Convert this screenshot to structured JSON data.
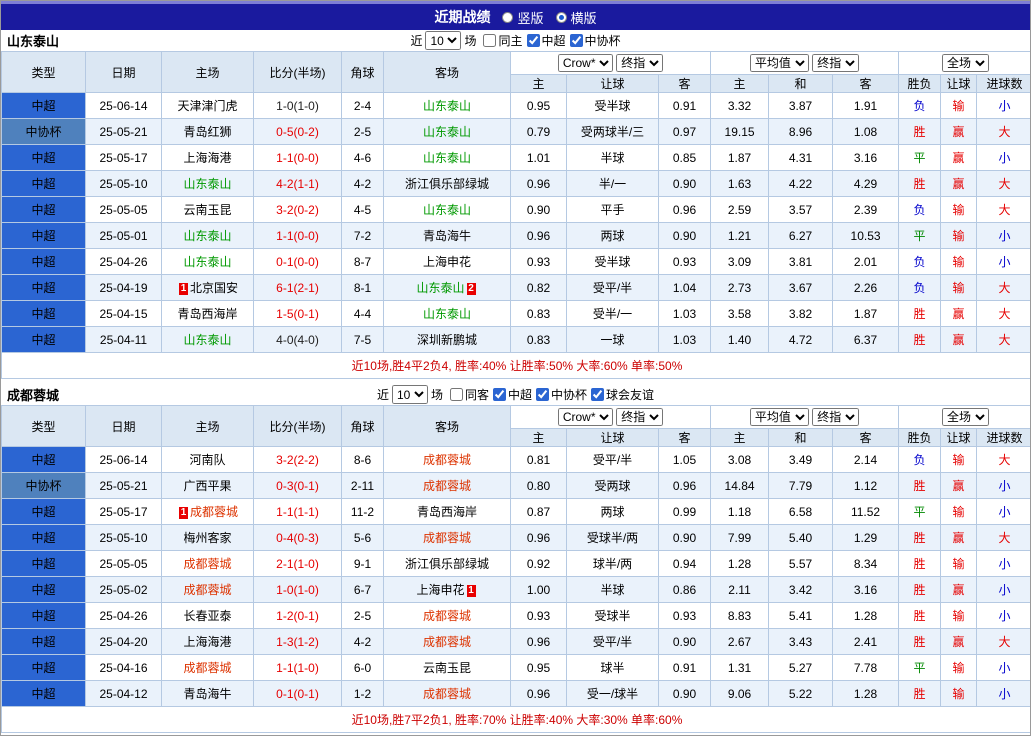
{
  "title_bar": {
    "title": "近期战绩",
    "radio_vertical": "竖版",
    "radio_horizontal": "横版"
  },
  "colors": {
    "league": {
      "中超": "#2b65d2",
      "中协杯": "#4f81bd"
    },
    "score": "#e60000",
    "score_dark": "#222222",
    "result_map": {
      "胜": "#e60000",
      "平": "#008800",
      "负": "#0000cc",
      "赢": "#e60000",
      "输": "#e60000",
      "大": "#e60000",
      "小": "#0000cc"
    }
  },
  "tables": [
    {
      "team": "山东泰山",
      "team_color": "#009900",
      "filter": {
        "near_label": "近",
        "count": "10",
        "games_label": "场",
        "checkboxes": [
          {
            "label": "同主",
            "checked": false
          },
          {
            "label": "中超",
            "checked": true
          },
          {
            "label": "中协杯",
            "checked": true
          }
        ]
      },
      "header": {
        "cols": [
          "类型",
          "日期",
          "主场",
          "比分(半场)",
          "角球",
          "客场"
        ],
        "odds_group": {
          "select1": "Crow*",
          "select2": "终指",
          "cols": [
            "主",
            "让球",
            "客"
          ]
        },
        "avg_group": {
          "select1": "平均值",
          "select2": "终指",
          "cols": [
            "主",
            "和",
            "客"
          ]
        },
        "result_group": {
          "select": "全场",
          "cols": [
            "胜负",
            "让球",
            "进球数"
          ]
        }
      },
      "rows": [
        {
          "league": "中超",
          "date": "25-06-14",
          "home": "天津津门虎",
          "home_cards": 0,
          "score": "1-0(1-0)",
          "score_dark": true,
          "corners": "2-4",
          "away": "山东泰山",
          "away_cards": 0,
          "highlight": "away",
          "odds_home": "0.95",
          "handicap": "受半球",
          "odds_away": "0.91",
          "avg_home": "3.32",
          "avg_draw": "3.87",
          "avg_away": "1.91",
          "res_match": "负",
          "res_handicap": "输",
          "res_goals": "小"
        },
        {
          "league": "中协杯",
          "date": "25-05-21",
          "home": "青岛红狮",
          "home_cards": 0,
          "score": "0-5(0-2)",
          "score_dark": false,
          "corners": "2-5",
          "away": "山东泰山",
          "away_cards": 0,
          "highlight": "away",
          "odds_home": "0.79",
          "handicap": "受两球半/三",
          "odds_away": "0.97",
          "avg_home": "19.15",
          "avg_draw": "8.96",
          "avg_away": "1.08",
          "res_match": "胜",
          "res_handicap": "赢",
          "res_goals": "大"
        },
        {
          "league": "中超",
          "date": "25-05-17",
          "home": "上海海港",
          "home_cards": 0,
          "score": "1-1(0-0)",
          "score_dark": false,
          "corners": "4-6",
          "away": "山东泰山",
          "away_cards": 0,
          "highlight": "away",
          "odds_home": "1.01",
          "handicap": "半球",
          "odds_away": "0.85",
          "avg_home": "1.87",
          "avg_draw": "4.31",
          "avg_away": "3.16",
          "res_match": "平",
          "res_handicap": "赢",
          "res_goals": "小"
        },
        {
          "league": "中超",
          "date": "25-05-10",
          "home": "山东泰山",
          "home_cards": 0,
          "score": "4-2(1-1)",
          "score_dark": false,
          "corners": "4-2",
          "away": "浙江俱乐部绿城",
          "away_cards": 0,
          "highlight": "home",
          "odds_home": "0.96",
          "handicap": "半/一",
          "odds_away": "0.90",
          "avg_home": "1.63",
          "avg_draw": "4.22",
          "avg_away": "4.29",
          "res_match": "胜",
          "res_handicap": "赢",
          "res_goals": "大"
        },
        {
          "league": "中超",
          "date": "25-05-05",
          "home": "云南玉昆",
          "home_cards": 0,
          "score": "3-2(0-2)",
          "score_dark": false,
          "corners": "4-5",
          "away": "山东泰山",
          "away_cards": 0,
          "highlight": "away",
          "odds_home": "0.90",
          "handicap": "平手",
          "odds_away": "0.96",
          "avg_home": "2.59",
          "avg_draw": "3.57",
          "avg_away": "2.39",
          "res_match": "负",
          "res_handicap": "输",
          "res_goals": "大"
        },
        {
          "league": "中超",
          "date": "25-05-01",
          "home": "山东泰山",
          "home_cards": 0,
          "score": "1-1(0-0)",
          "score_dark": false,
          "corners": "7-2",
          "away": "青岛海牛",
          "away_cards": 0,
          "highlight": "home",
          "odds_home": "0.96",
          "handicap": "两球",
          "odds_away": "0.90",
          "avg_home": "1.21",
          "avg_draw": "6.27",
          "avg_away": "10.53",
          "res_match": "平",
          "res_handicap": "输",
          "res_goals": "小"
        },
        {
          "league": "中超",
          "date": "25-04-26",
          "home": "山东泰山",
          "home_cards": 0,
          "score": "0-1(0-0)",
          "score_dark": false,
          "corners": "8-7",
          "away": "上海申花",
          "away_cards": 0,
          "highlight": "home",
          "odds_home": "0.93",
          "handicap": "受半球",
          "odds_away": "0.93",
          "avg_home": "3.09",
          "avg_draw": "3.81",
          "avg_away": "2.01",
          "res_match": "负",
          "res_handicap": "输",
          "res_goals": "小"
        },
        {
          "league": "中超",
          "date": "25-04-19",
          "home": "北京国安",
          "home_cards": 1,
          "score": "6-1(2-1)",
          "score_dark": false,
          "corners": "8-1",
          "away": "山东泰山",
          "away_cards": 2,
          "highlight": "away",
          "odds_home": "0.82",
          "handicap": "受平/半",
          "odds_away": "1.04",
          "avg_home": "2.73",
          "avg_draw": "3.67",
          "avg_away": "2.26",
          "res_match": "负",
          "res_handicap": "输",
          "res_goals": "大"
        },
        {
          "league": "中超",
          "date": "25-04-15",
          "home": "青岛西海岸",
          "home_cards": 0,
          "score": "1-5(0-1)",
          "score_dark": false,
          "corners": "4-4",
          "away": "山东泰山",
          "away_cards": 0,
          "highlight": "away",
          "odds_home": "0.83",
          "handicap": "受半/一",
          "odds_away": "1.03",
          "avg_home": "3.58",
          "avg_draw": "3.82",
          "avg_away": "1.87",
          "res_match": "胜",
          "res_handicap": "赢",
          "res_goals": "大"
        },
        {
          "league": "中超",
          "date": "25-04-11",
          "home": "山东泰山",
          "home_cards": 0,
          "score": "4-0(4-0)",
          "score_dark": true,
          "corners": "7-5",
          "away": "深圳新鹏城",
          "away_cards": 0,
          "highlight": "home",
          "odds_home": "0.83",
          "handicap": "一球",
          "odds_away": "1.03",
          "avg_home": "1.40",
          "avg_draw": "4.72",
          "avg_away": "6.37",
          "res_match": "胜",
          "res_handicap": "赢",
          "res_goals": "大"
        }
      ],
      "summary": "近10场,胜4平2负4, 胜率:40% 让胜率:50% 大率:60% 单率:50%"
    },
    {
      "team": "成都蓉城",
      "team_color": "#dd3300",
      "filter": {
        "near_label": "近",
        "count": "10",
        "games_label": "场",
        "checkboxes": [
          {
            "label": "同客",
            "checked": false
          },
          {
            "label": "中超",
            "checked": true
          },
          {
            "label": "中协杯",
            "checked": true
          },
          {
            "label": "球会友谊",
            "checked": true
          }
        ]
      },
      "header": {
        "cols": [
          "类型",
          "日期",
          "主场",
          "比分(半场)",
          "角球",
          "客场"
        ],
        "odds_group": {
          "select1": "Crow*",
          "select2": "终指",
          "cols": [
            "主",
            "让球",
            "客"
          ]
        },
        "avg_group": {
          "select1": "平均值",
          "select2": "终指",
          "cols": [
            "主",
            "和",
            "客"
          ]
        },
        "result_group": {
          "select": "全场",
          "cols": [
            "胜负",
            "让球",
            "进球数"
          ]
        }
      },
      "rows": [
        {
          "league": "中超",
          "date": "25-06-14",
          "home": "河南队",
          "home_cards": 0,
          "score": "3-2(2-2)",
          "score_dark": false,
          "corners": "8-6",
          "away": "成都蓉城",
          "away_cards": 0,
          "highlight": "away",
          "odds_home": "0.81",
          "handicap": "受平/半",
          "odds_away": "1.05",
          "avg_home": "3.08",
          "avg_draw": "3.49",
          "avg_away": "2.14",
          "res_match": "负",
          "res_handicap": "输",
          "res_goals": "大"
        },
        {
          "league": "中协杯",
          "date": "25-05-21",
          "home": "广西平果",
          "home_cards": 0,
          "score": "0-3(0-1)",
          "score_dark": false,
          "corners": "2-11",
          "away": "成都蓉城",
          "away_cards": 0,
          "highlight": "away",
          "odds_home": "0.80",
          "handicap": "受两球",
          "odds_away": "0.96",
          "avg_home": "14.84",
          "avg_draw": "7.79",
          "avg_away": "1.12",
          "res_match": "胜",
          "res_handicap": "赢",
          "res_goals": "小"
        },
        {
          "league": "中超",
          "date": "25-05-17",
          "home": "成都蓉城",
          "home_cards": 1,
          "score": "1-1(1-1)",
          "score_dark": false,
          "corners": "11-2",
          "away": "青岛西海岸",
          "away_cards": 0,
          "highlight": "home",
          "odds_home": "0.87",
          "handicap": "两球",
          "odds_away": "0.99",
          "avg_home": "1.18",
          "avg_draw": "6.58",
          "avg_away": "11.52",
          "res_match": "平",
          "res_handicap": "输",
          "res_goals": "小"
        },
        {
          "league": "中超",
          "date": "25-05-10",
          "home": "梅州客家",
          "home_cards": 0,
          "score": "0-4(0-3)",
          "score_dark": false,
          "corners": "5-6",
          "away": "成都蓉城",
          "away_cards": 0,
          "highlight": "away",
          "odds_home": "0.96",
          "handicap": "受球半/两",
          "odds_away": "0.90",
          "avg_home": "7.99",
          "avg_draw": "5.40",
          "avg_away": "1.29",
          "res_match": "胜",
          "res_handicap": "赢",
          "res_goals": "大"
        },
        {
          "league": "中超",
          "date": "25-05-05",
          "home": "成都蓉城",
          "home_cards": 0,
          "score": "2-1(1-0)",
          "score_dark": false,
          "corners": "9-1",
          "away": "浙江俱乐部绿城",
          "away_cards": 0,
          "highlight": "home",
          "odds_home": "0.92",
          "handicap": "球半/两",
          "odds_away": "0.94",
          "avg_home": "1.28",
          "avg_draw": "5.57",
          "avg_away": "8.34",
          "res_match": "胜",
          "res_handicap": "输",
          "res_goals": "小"
        },
        {
          "league": "中超",
          "date": "25-05-02",
          "home": "成都蓉城",
          "home_cards": 0,
          "score": "1-0(1-0)",
          "score_dark": false,
          "corners": "6-7",
          "away": "上海申花",
          "away_cards": 1,
          "highlight": "home",
          "odds_home": "1.00",
          "handicap": "半球",
          "odds_away": "0.86",
          "avg_home": "2.11",
          "avg_draw": "3.42",
          "avg_away": "3.16",
          "res_match": "胜",
          "res_handicap": "赢",
          "res_goals": "小"
        },
        {
          "league": "中超",
          "date": "25-04-26",
          "home": "长春亚泰",
          "home_cards": 0,
          "score": "1-2(0-1)",
          "score_dark": false,
          "corners": "2-5",
          "away": "成都蓉城",
          "away_cards": 0,
          "highlight": "away",
          "odds_home": "0.93",
          "handicap": "受球半",
          "odds_away": "0.93",
          "avg_home": "8.83",
          "avg_draw": "5.41",
          "avg_away": "1.28",
          "res_match": "胜",
          "res_handicap": "输",
          "res_goals": "小"
        },
        {
          "league": "中超",
          "date": "25-04-20",
          "home": "上海海港",
          "home_cards": 0,
          "score": "1-3(1-2)",
          "score_dark": false,
          "corners": "4-2",
          "away": "成都蓉城",
          "away_cards": 0,
          "highlight": "away",
          "odds_home": "0.96",
          "handicap": "受平/半",
          "odds_away": "0.90",
          "avg_home": "2.67",
          "avg_draw": "3.43",
          "avg_away": "2.41",
          "res_match": "胜",
          "res_handicap": "赢",
          "res_goals": "大"
        },
        {
          "league": "中超",
          "date": "25-04-16",
          "home": "成都蓉城",
          "home_cards": 0,
          "score": "1-1(1-0)",
          "score_dark": false,
          "corners": "6-0",
          "away": "云南玉昆",
          "away_cards": 0,
          "highlight": "home",
          "odds_home": "0.95",
          "handicap": "球半",
          "odds_away": "0.91",
          "avg_home": "1.31",
          "avg_draw": "5.27",
          "avg_away": "7.78",
          "res_match": "平",
          "res_handicap": "输",
          "res_goals": "小"
        },
        {
          "league": "中超",
          "date": "25-04-12",
          "home": "青岛海牛",
          "home_cards": 0,
          "score": "0-1(0-1)",
          "score_dark": false,
          "corners": "1-2",
          "away": "成都蓉城",
          "away_cards": 0,
          "highlight": "away",
          "odds_home": "0.96",
          "handicap": "受一/球半",
          "odds_away": "0.90",
          "avg_home": "9.06",
          "avg_draw": "5.22",
          "avg_away": "1.28",
          "res_match": "胜",
          "res_handicap": "输",
          "res_goals": "小"
        }
      ],
      "summary": "近10场,胜7平2负1, 胜率:70% 让胜率:40% 大率:30% 单率:60%"
    }
  ]
}
